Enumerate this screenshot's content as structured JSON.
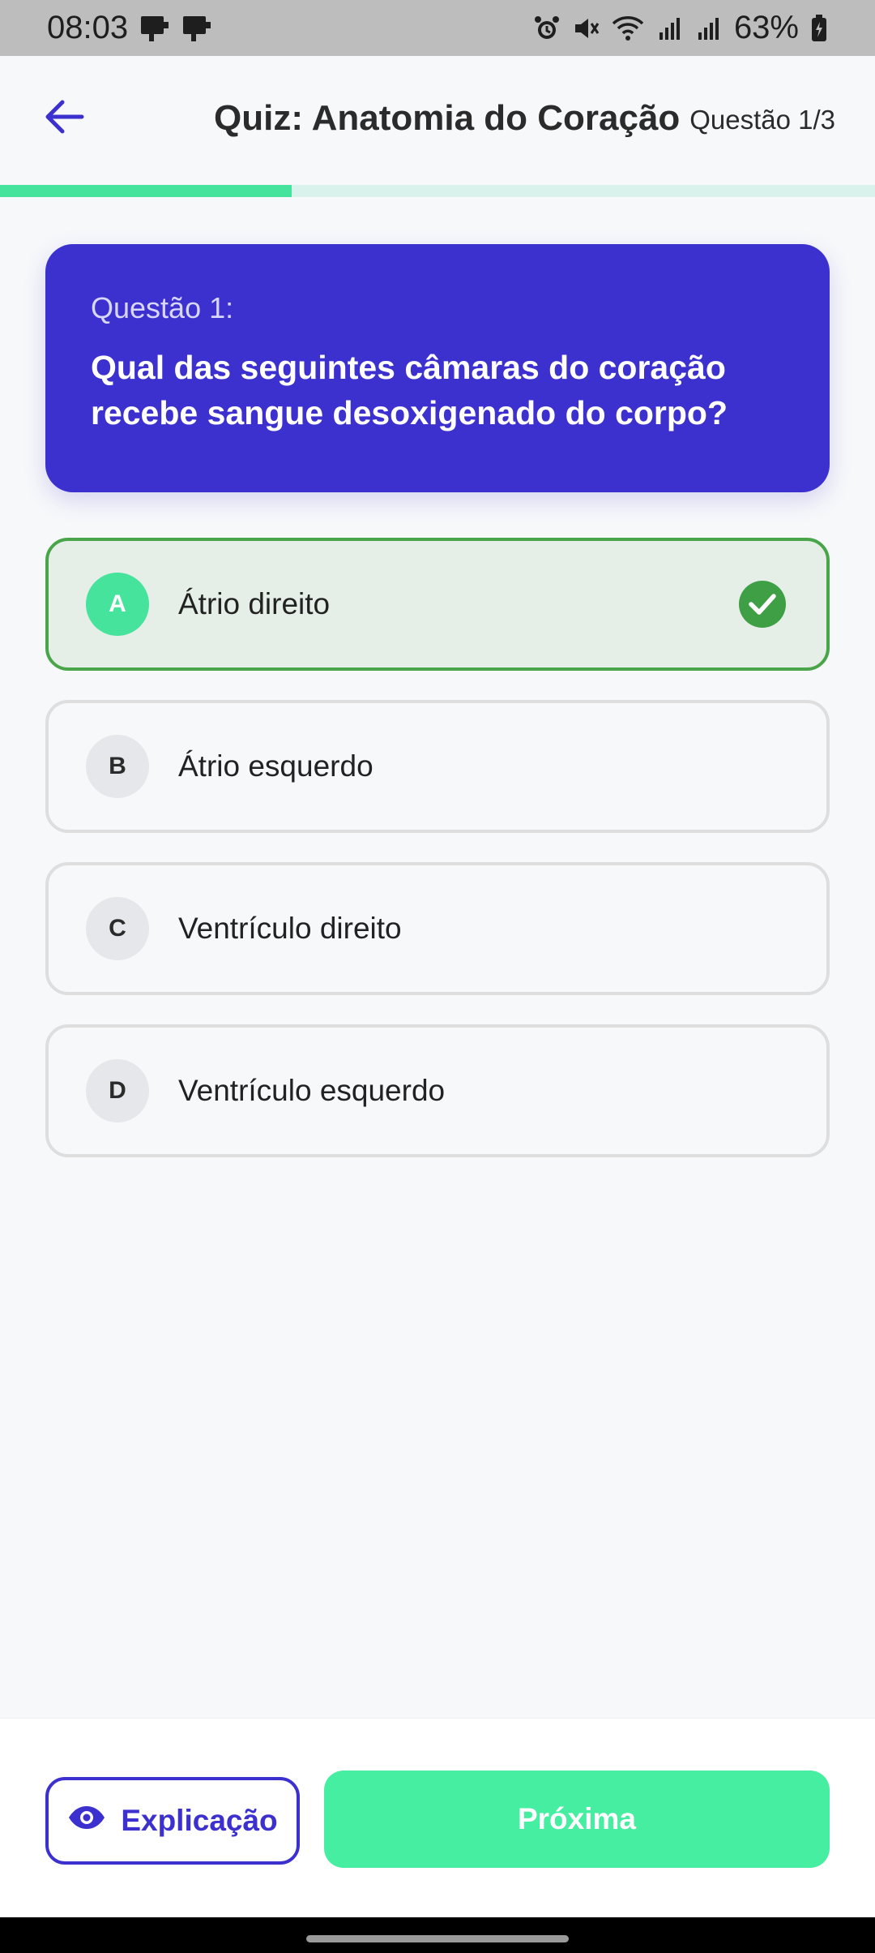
{
  "status_bar": {
    "time": "08:03",
    "battery_percent": "63%",
    "icons": [
      "notification-icon",
      "notification-icon",
      "alarm-icon",
      "mute-icon",
      "wifi-icon",
      "signal-icon",
      "signal-icon",
      "battery-icon"
    ]
  },
  "header": {
    "title": "Quiz: Anatomia do Coração",
    "counter": "Questão 1/3",
    "progress": 0.333
  },
  "question": {
    "number_label": "Questão 1:",
    "text": "Qual das seguintes câmaras do coração recebe sangue desoxigenado do corpo?"
  },
  "options": [
    {
      "letter": "A",
      "text": "Átrio direito",
      "state": "correct"
    },
    {
      "letter": "B",
      "text": "Átrio esquerdo",
      "state": "default"
    },
    {
      "letter": "C",
      "text": "Ventrículo direito",
      "state": "default"
    },
    {
      "letter": "D",
      "text": "Ventrículo esquerdo",
      "state": "default"
    }
  ],
  "footer": {
    "explain_label": "Explicação",
    "next_label": "Próxima"
  },
  "colors": {
    "primary": "#3c31cf",
    "accent": "#45e39c",
    "correct_border": "#4aa54a",
    "correct_bg": "#e6efe7"
  }
}
